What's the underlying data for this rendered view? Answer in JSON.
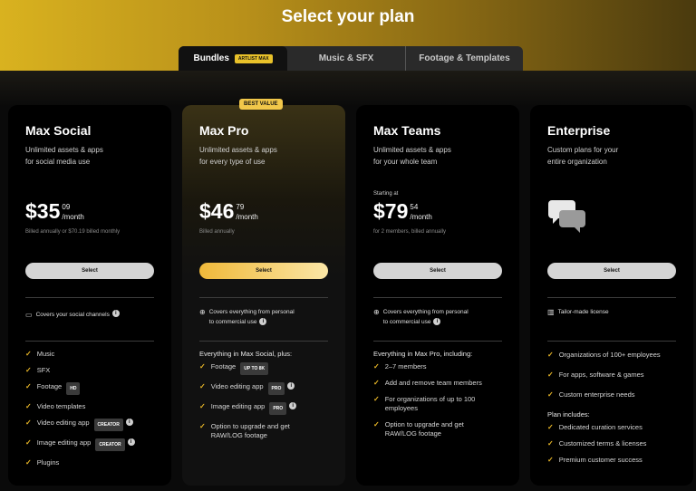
{
  "header": {
    "title": "Select your plan"
  },
  "tabs": [
    {
      "label": "Bundles",
      "badge": "ARTLIST MAX"
    },
    {
      "label": "Music & SFX"
    },
    {
      "label": "Footage & Templates"
    }
  ],
  "best_value": "BEST VALUE",
  "plans": [
    {
      "title": "Max Social",
      "desc": [
        "Unlimited assets & apps",
        "for social media use"
      ],
      "price_main": "$35",
      "price_cents": "09",
      "per": "/month",
      "billed": "Billed annually or $70.19 billed monthly",
      "select": "Select",
      "cover": "Covers your social channels",
      "features": [
        "Music",
        "SFX",
        "Footage",
        "Video templates",
        "Video editing app",
        "Image editing app",
        "Plugins"
      ],
      "tags": {
        "footage": "HD",
        "video": "CREATOR",
        "image": "CREATOR"
      }
    },
    {
      "title": "Max Pro",
      "desc": [
        "Unlimited assets & apps",
        "for every type of use"
      ],
      "price_main": "$46",
      "price_cents": "79",
      "per": "/month",
      "billed": "Billed annually",
      "select": "Select",
      "cover": [
        "Covers everything from personal",
        "to commercial use"
      ],
      "list_header": "Everything in Max Social, plus:",
      "features": [
        "Footage",
        "Video editing app",
        "Image editing app",
        "Option to upgrade and get",
        "RAW/LOG footage"
      ],
      "tags": {
        "footage": "UP TO 8K",
        "video": "PRO",
        "image": "PRO"
      }
    },
    {
      "title": "Max Teams",
      "desc": [
        "Unlimited assets & apps",
        "for your whole team"
      ],
      "starting": "Starting at",
      "price_main": "$79",
      "price_cents": "54",
      "per": "/month",
      "billed": "for 2 members, billed annually",
      "select": "Select",
      "cover": [
        "Covers everything from personal",
        "to commercial use"
      ],
      "list_header": "Everything in Max Pro, including:",
      "features": [
        "2–7 members",
        "Add and remove team members",
        "For organizations of up to 100",
        "employees",
        "Option to upgrade and get",
        "RAW/LOG footage"
      ]
    },
    {
      "title": "Enterprise",
      "desc": [
        "Custom plans for your",
        "entire organization"
      ],
      "select": "Select",
      "cover": "Tailor-made license",
      "features": [
        "Organizations of 100+ employees",
        "For apps, software & games",
        "Custom enterprise needs"
      ],
      "list_header2": "Plan includes:",
      "features2": [
        "Dedicated curation services",
        "Customized terms & licenses",
        "Premium customer success"
      ]
    }
  ],
  "colors": {
    "accent": "#e8b627",
    "card": "#000000",
    "pro_gold": "#f0b93a"
  }
}
